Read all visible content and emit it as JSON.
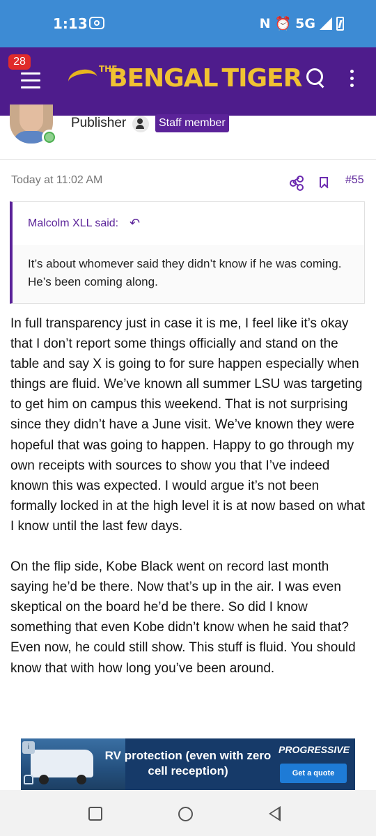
{
  "status_bar": {
    "time": "1:13",
    "network": "5G",
    "icons": [
      "cast-icon",
      "nfc-icon",
      "alarm-icon",
      "signal-icon",
      "battery-charging-icon"
    ]
  },
  "header": {
    "notification_count": "28",
    "logo": {
      "the": "THE",
      "bengal": "BENGAL",
      "tiger": "TIGER"
    },
    "colors": {
      "background": "#4e1c8c",
      "logo": "#f0c232",
      "badge": "#e02b2b"
    }
  },
  "post": {
    "author_role": "Publisher",
    "badge": "Staff member",
    "date": "Today at 11:02 AM",
    "number": "#55",
    "quote": {
      "author": "Malcolm XLL said:",
      "text": "It’s about whomever said they didn’t know if he was coming. He’s been coming along."
    },
    "paragraphs": [
      "In full transparency just in case it is me, I feel like it’s okay that I don’t report some things officially and stand on the table and say X is going to for sure happen especially when things are fluid. We’ve known all summer LSU was targeting to get him on campus this weekend. That is not surprising since they didn’t have a June visit. We’ve known they were hopeful that was going to happen. Happy to go through my own receipts with sources to show you that I’ve indeed known this was expected. I would argue it’s not been formally locked in at the high level it is at now based on what I know until the last few days.",
      "On the flip side, Kobe Black went on record last month saying he’d be there. Now that’s up in the air. I was even skeptical on the board he’d be there. So did I know something that even Kobe didn’t know when he said that? Even now, he could still show. This stuff is fluid. You should know that with how long you’ve been around."
    ],
    "accent_color": "#5b2399"
  },
  "ad": {
    "headline": "RV protection (even with zero cell reception)",
    "brand": "PROGRESSIVE",
    "cta": "Get a quote"
  },
  "nav": {
    "icons": [
      "recents-square-icon",
      "home-circle-icon",
      "back-triangle-icon"
    ]
  }
}
